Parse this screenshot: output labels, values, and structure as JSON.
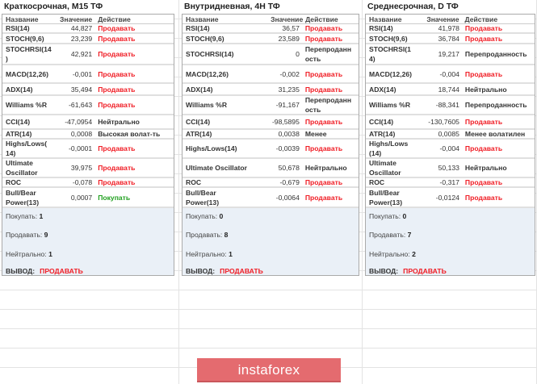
{
  "headers": {
    "name": "Название",
    "value": "Значение",
    "action": "Действие"
  },
  "summary_labels": {
    "buy": "Покупать:",
    "sell": "Продавать:",
    "neutral": "Нейтрально:",
    "verdict": "ВЫВОД:"
  },
  "panels": [
    {
      "title": "Краткосрочная, M15 ТФ",
      "rows": [
        {
          "name": "RSI(14)",
          "value": "44,827",
          "action": "Продавать",
          "type": "sell"
        },
        {
          "name": "STOCH(9,6)",
          "value": "23,239",
          "action": "Продавать",
          "type": "sell"
        },
        {
          "name": "STOCHRSI(14\n)",
          "value": "42,921",
          "action": "Продавать",
          "type": "sell"
        },
        {
          "name": "MACD(12,26)",
          "value": "-0,001",
          "action": "Продавать",
          "type": "sell"
        },
        {
          "name": "ADX(14)",
          "value": "35,494",
          "action": "Продавать",
          "type": "sell"
        },
        {
          "name": "Williams %R",
          "value": "-61,643",
          "action": "Продавать",
          "type": "sell"
        },
        {
          "name": "CCI(14)",
          "value": "-47,0954",
          "action": "Нейтрально",
          "type": "neutral"
        },
        {
          "name": "ATR(14)",
          "value": "0,0008",
          "action": "Высокая волат-ть",
          "type": "neutral"
        },
        {
          "name": "Highs/Lows(\n14)",
          "value": "-0,0001",
          "action": "Продавать",
          "type": "sell"
        },
        {
          "name": "Ultimate\nOscillator",
          "value": "39,975",
          "action": "Продавать",
          "type": "sell"
        },
        {
          "name": "ROC",
          "value": "-0,078",
          "action": "Продавать",
          "type": "sell"
        },
        {
          "name": "Bull/Bear\nPower(13)",
          "value": "0,0007",
          "action": "Покупать",
          "type": "buy"
        }
      ],
      "summary": {
        "buy": "1",
        "sell": "9",
        "neutral": "1",
        "verdict": "ПРОДАВАТЬ"
      }
    },
    {
      "title": "Внутридневная, 4H ТФ",
      "rows": [
        {
          "name": "RSI(14)",
          "value": "36,57",
          "action": "Продавать",
          "type": "sell"
        },
        {
          "name": "STOCH(9,6)",
          "value": "23,589",
          "action": "Продавать",
          "type": "sell"
        },
        {
          "name": "STOCHRSI(14)",
          "value": "0",
          "action": "Перепроданн\nость",
          "type": "neutral"
        },
        {
          "name": "MACD(12,26)",
          "value": "-0,002",
          "action": "Продавать",
          "type": "sell"
        },
        {
          "name": "ADX(14)",
          "value": "31,235",
          "action": "Продавать",
          "type": "sell"
        },
        {
          "name": "Williams %R",
          "value": "-91,167",
          "action": "Перепроданн\nость",
          "type": "neutral"
        },
        {
          "name": "CCI(14)",
          "value": "-98,5895",
          "action": "Продавать",
          "type": "sell"
        },
        {
          "name": "ATR(14)",
          "value": "0,0038",
          "action": "Менее",
          "type": "neutral"
        },
        {
          "name": "Highs/Lows(14)",
          "value": "-0,0039",
          "action": "Продавать",
          "type": "sell"
        },
        {
          "name": "Ultimate Oscillator",
          "value": "50,678",
          "action": "Нейтрально",
          "type": "neutral"
        },
        {
          "name": "ROC",
          "value": "-0,679",
          "action": "Продавать",
          "type": "sell"
        },
        {
          "name": "Bull/Bear\nPower(13)",
          "value": "-0,0064",
          "action": "Продавать",
          "type": "sell"
        }
      ],
      "summary": {
        "buy": "0",
        "sell": "8",
        "neutral": "1",
        "verdict": "ПРОДАВАТЬ"
      }
    },
    {
      "title": "Среднесрочная, D ТФ",
      "rows": [
        {
          "name": "RSI(14)",
          "value": "41,978",
          "action": "Продавать",
          "type": "sell"
        },
        {
          "name": "STOCH(9,6)",
          "value": "36,784",
          "action": "Продавать",
          "type": "sell"
        },
        {
          "name": "STOCHRSI(1\n4)",
          "value": "19,217",
          "action": "Перепроданность",
          "type": "neutral"
        },
        {
          "name": "MACD(12,26)",
          "value": "-0,004",
          "action": "Продавать",
          "type": "sell"
        },
        {
          "name": "ADX(14)",
          "value": "18,744",
          "action": "Нейтрально",
          "type": "neutral"
        },
        {
          "name": "Williams %R",
          "value": "-88,341",
          "action": "Перепроданность",
          "type": "neutral"
        },
        {
          "name": "CCI(14)",
          "value": "-130,7605",
          "action": "Продавать",
          "type": "sell"
        },
        {
          "name": "ATR(14)",
          "value": "0,0085",
          "action": "Менее волатилен",
          "type": "neutral"
        },
        {
          "name": "Highs/Lows\n(14)",
          "value": "-0,004",
          "action": "Продавать",
          "type": "sell"
        },
        {
          "name": "Ultimate\nOscillator",
          "value": "50,133",
          "action": "Нейтрально",
          "type": "neutral"
        },
        {
          "name": "ROC",
          "value": "-0,317",
          "action": "Продавать",
          "type": "sell"
        },
        {
          "name": "Bull/Bear\nPower(13)",
          "value": "-0,0124",
          "action": "Продавать",
          "type": "sell"
        }
      ],
      "summary": {
        "buy": "0",
        "sell": "7",
        "neutral": "2",
        "verdict": "ПРОДАВАТЬ"
      }
    }
  ],
  "banner": {
    "logo_text": "instaforex"
  }
}
